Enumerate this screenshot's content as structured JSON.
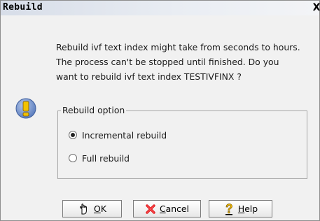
{
  "window": {
    "title": "Rebuild",
    "close_symbol": "X"
  },
  "message": {
    "lines": [
      "Rebuild ivf text index might take from seconds to hours.",
      "The process can't be stopped until finished. Do you",
      "want to rebuild ivf text index TESTIVFINX  ?"
    ]
  },
  "icon": "warning-exclamation-icon",
  "rebuild_option": {
    "legend": "Rebuild option",
    "options": [
      {
        "label": "Incremental rebuild",
        "selected": true
      },
      {
        "label": "Full rebuild",
        "selected": false
      }
    ]
  },
  "buttons": {
    "ok": {
      "mnemonic": "O",
      "rest": "K",
      "icon": "hand-pointer-icon"
    },
    "cancel": {
      "mnemonic": "C",
      "rest": "ancel",
      "icon": "red-x-icon"
    },
    "help": {
      "mnemonic": "H",
      "rest": "elp",
      "icon": "question-mark-icon"
    }
  },
  "colors": {
    "accent_warning": "#f2c200",
    "cancel_icon": "#e0191e",
    "help_icon": "#f0b800"
  }
}
